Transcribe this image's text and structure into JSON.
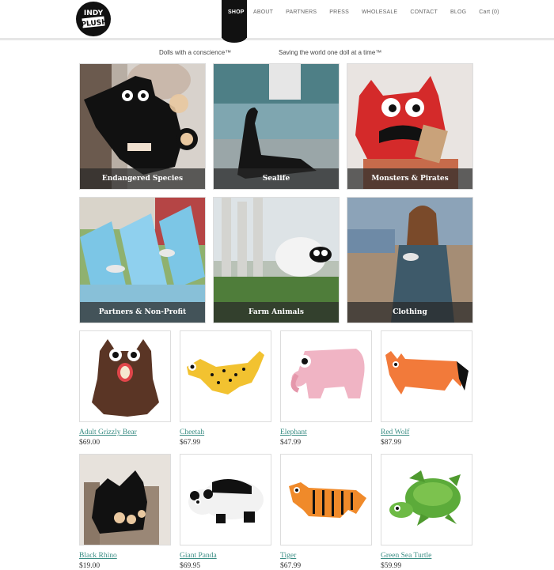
{
  "site": {
    "logo_text": "INDY PLUSH"
  },
  "nav": {
    "items": [
      {
        "label": "SHOP",
        "active": true
      },
      {
        "label": "ABOUT"
      },
      {
        "label": "PARTNERS"
      },
      {
        "label": "PRESS"
      },
      {
        "label": "WHOLESALE"
      },
      {
        "label": "CONTACT"
      },
      {
        "label": "BLOG"
      }
    ],
    "cart_label": "Cart (0)"
  },
  "taglines": {
    "left": "Dolls with a conscience™",
    "right": "Saving the world one doll at a time™"
  },
  "categories": [
    {
      "label": "Endangered Species"
    },
    {
      "label": "Sealife"
    },
    {
      "label": "Monsters & Pirates"
    },
    {
      "label": "Partners & Non-Profit"
    },
    {
      "label": "Farm Animals"
    },
    {
      "label": "Clothing"
    }
  ],
  "products": [
    {
      "name": "Adult Grizzly Bear",
      "price": "$69.00"
    },
    {
      "name": "Cheetah",
      "price": "$67.99"
    },
    {
      "name": "Elephant",
      "price": "$47.99"
    },
    {
      "name": "Red Wolf",
      "price": "$87.99"
    },
    {
      "name": "Black Rhino",
      "price": "$19.00"
    },
    {
      "name": "Giant Panda",
      "price": "$69.95"
    },
    {
      "name": "Tiger",
      "price": "$67.99"
    },
    {
      "name": "Green Sea Turtle",
      "price": "$59.99"
    }
  ],
  "colors": {
    "link": "#3a8d84",
    "nav_active_bg": "#111111",
    "label_overlay": "#282828"
  }
}
